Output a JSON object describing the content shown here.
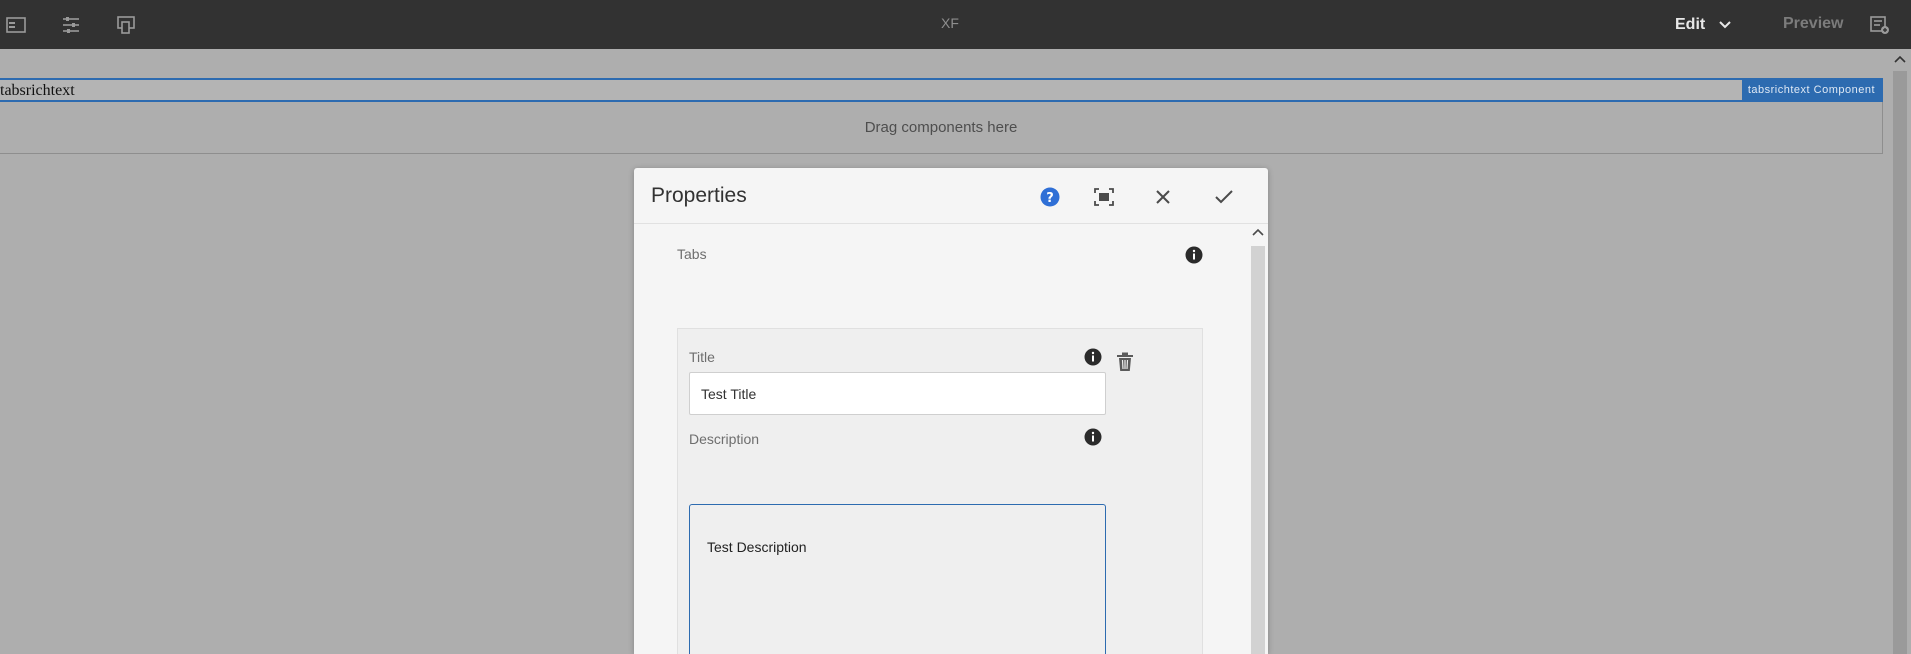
{
  "app": {
    "title": "XF"
  },
  "topbar": {
    "left_icons": [
      "side-panel-icon",
      "properties-icon",
      "emulator-icon"
    ],
    "mode_label": "Edit",
    "preview_label": "Preview",
    "right_icon": "page-info-icon"
  },
  "component": {
    "name": "tabsrichtext",
    "badge": "tabsrichtext Component",
    "drop_placeholder": "Drag components here"
  },
  "dialog": {
    "title": "Properties",
    "header_icons": [
      "help-icon",
      "fullscreen-icon",
      "close-icon",
      "check-icon"
    ],
    "tabs_label": "Tabs",
    "item": {
      "title_label": "Title",
      "title_value": "Test Title",
      "description_label": "Description",
      "description_value": "Test Description"
    }
  },
  "colors": {
    "topbar": "#323232",
    "accent_blue": "#2d6bb0",
    "canvas": "#aeaeae",
    "dialog_bg": "#f5f5f5"
  }
}
